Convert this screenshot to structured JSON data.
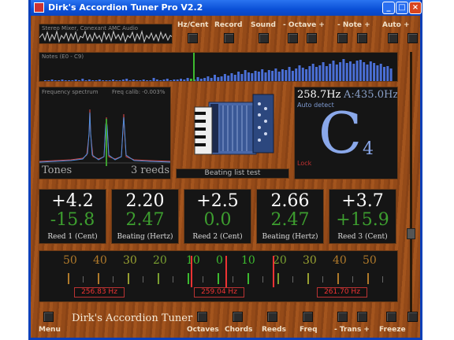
{
  "window": {
    "title": "Dirk's Accordion Tuner Pro V2.2"
  },
  "top_controls": [
    "Hz/Cent",
    "Record",
    "Sound",
    "- Octave +",
    "- Note +",
    "Auto +"
  ],
  "input_source": "Stereo Mixer, Conexant AMC Audio",
  "notes_panel": {
    "label": "Notes (E0 - C9)"
  },
  "spectrum": {
    "label": "Frequency spectrum",
    "calib": "Freq calib: -0.003%",
    "tones_label": "Tones",
    "reeds_label": "3 reeds"
  },
  "center": {
    "caption": "Beating list test"
  },
  "note_display": {
    "freq": "258.7Hz",
    "ref": "A:435.0Hz",
    "mode": "Auto detect",
    "note": "C",
    "octave": "4",
    "lock": "Lock"
  },
  "meters": [
    {
      "v1": "+4.2",
      "v2": "-15.8",
      "label": "Reed 1 (Cent)"
    },
    {
      "v1": "2.20",
      "v2": "2.47",
      "label": "Beating (Hertz)"
    },
    {
      "v1": "+2.5",
      "v2": "0.0",
      "label": "Reed 2 (Cent)"
    },
    {
      "v1": "2.66",
      "v2": "2.47",
      "label": "Beating (Hertz)"
    },
    {
      "v1": "+3.7",
      "v2": "+15.9",
      "label": "Reed 3 (Cent)"
    }
  ],
  "scale": {
    "numbers": [
      "50",
      "40",
      "30",
      "20",
      "10",
      "0",
      "10",
      "20",
      "30",
      "40",
      "50"
    ],
    "freqs": [
      "256.83 Hz",
      "259.04 Hz",
      "261.70 Hz"
    ]
  },
  "bottom": {
    "menu": "Menu",
    "brand": "Dirk's Accordion Tuner",
    "items": [
      "Octaves",
      "Chords",
      "Reeds",
      "Freq",
      "- Trans +",
      "Freeze"
    ]
  }
}
